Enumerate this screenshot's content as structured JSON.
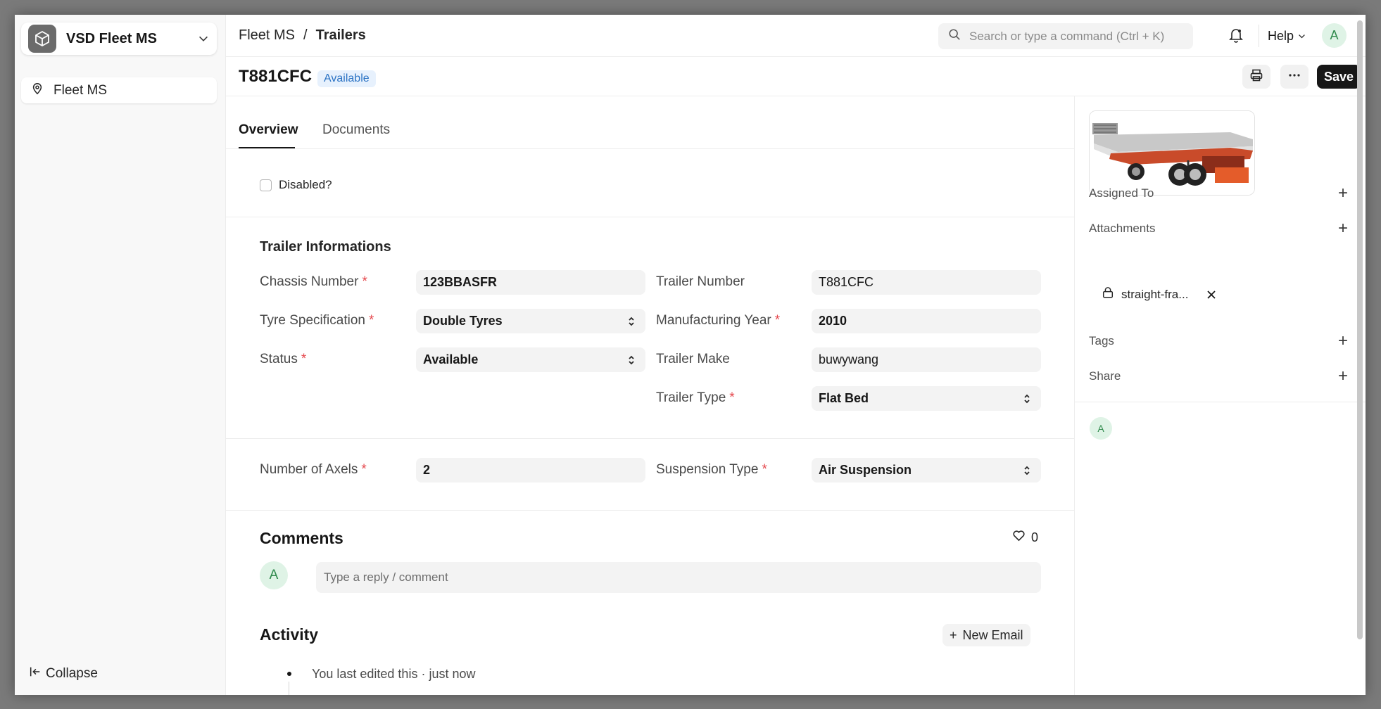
{
  "app": {
    "name": "VSD Fleet MS"
  },
  "sidebar": {
    "items": [
      {
        "label": "Fleet MS",
        "icon": "map-pin-icon"
      }
    ],
    "collapse_label": "Collapse"
  },
  "topbar": {
    "breadcrumb": [
      "Fleet MS",
      "Trailers"
    ],
    "breadcrumb_sep": "/",
    "search_placeholder": "Search or type a command (Ctrl + K)",
    "help_label": "Help",
    "avatar_initial": "A"
  },
  "doc": {
    "title": "T881CFC",
    "status_badge": "Available",
    "save_label": "Save",
    "badge_color": "#2b73c4"
  },
  "tabs": [
    {
      "label": "Overview",
      "active": true
    },
    {
      "label": "Documents",
      "active": false
    }
  ],
  "form": {
    "disabled_label": "Disabled?",
    "disabled_checked": false,
    "section_title": "Trailer Informations",
    "required_mark": "*",
    "fields": {
      "chassis_number": {
        "label": "Chassis Number",
        "value": "123BBASFR",
        "required": true
      },
      "tyre_specification": {
        "label": "Tyre Specification",
        "value": "Double Tyres",
        "required": true
      },
      "status": {
        "label": "Status",
        "value": "Available",
        "required": true
      },
      "trailer_number": {
        "label": "Trailer Number",
        "value": "T881CFC",
        "required": false
      },
      "manufacturing_year": {
        "label": "Manufacturing Year",
        "value": "2010",
        "required": true
      },
      "trailer_make": {
        "label": "Trailer Make",
        "value": "buwywang",
        "required": false
      },
      "trailer_type": {
        "label": "Trailer Type",
        "value": "Flat Bed",
        "required": true
      },
      "number_of_axels": {
        "label": "Number of Axels",
        "value": "2",
        "required": true
      },
      "suspension_type": {
        "label": "Suspension Type",
        "value": "Air Suspension",
        "required": true
      }
    }
  },
  "comments": {
    "title": "Comments",
    "likes": "0",
    "avatar_initial": "A",
    "placeholder": "Type a reply / comment"
  },
  "activity": {
    "title": "Activity",
    "new_email_label": "New Email",
    "items": [
      {
        "text": "You last edited this · just now"
      }
    ]
  },
  "rightpanel": {
    "assigned_to_label": "Assigned To",
    "attachments_label": "Attachments",
    "attachment_name": "straight-fra...",
    "tags_label": "Tags",
    "share_label": "Share",
    "avatar_initial": "A"
  },
  "colors": {
    "primary": "#171717",
    "required": "#e5484d",
    "avatar_bg": "#dff3e6",
    "avatar_fg": "#2f8a4c"
  }
}
